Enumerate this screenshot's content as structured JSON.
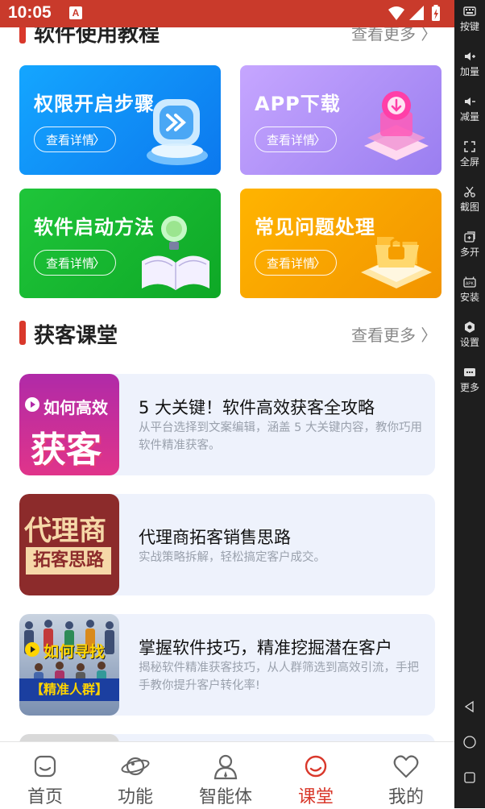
{
  "status_bar": {
    "time": "10:05",
    "app_icon": "A"
  },
  "side_bar": {
    "items": [
      {
        "label": "按键",
        "icon": "keyboard-icon"
      },
      {
        "label": "加量",
        "icon": "volume-up-icon"
      },
      {
        "label": "减量",
        "icon": "volume-down-icon"
      },
      {
        "label": "全屏",
        "icon": "fullscreen-icon"
      },
      {
        "label": "截图",
        "icon": "scissors-icon"
      },
      {
        "label": "多开",
        "icon": "multi-window-icon"
      },
      {
        "label": "安装",
        "icon": "apk-icon"
      },
      {
        "label": "设置",
        "icon": "settings-icon"
      },
      {
        "label": "更多",
        "icon": "more-icon"
      }
    ]
  },
  "tutorial_section": {
    "title": "软件使用教程",
    "see_more": "查看更多"
  },
  "tutorial_cards": [
    {
      "title": "权限开启步骤",
      "button": "查看详情",
      "color": "#1a8cf5"
    },
    {
      "title": "APP下载",
      "button": "查看详情",
      "color": "#a88cf2"
    },
    {
      "title": "软件启动方法",
      "button": "查看详情",
      "color": "#13b32f"
    },
    {
      "title": "常见问题处理",
      "button": "查看详情",
      "color": "#f0a300"
    }
  ],
  "course_section": {
    "title": "获客课堂",
    "see_more": "查看更多"
  },
  "lessons": [
    {
      "title": "5 大关键！软件高效获客全攻略",
      "desc": "从平台选择到文案编辑，涵盖 5 大关键内容，教你巧用软件精准获客。",
      "thumb_line1": "如何高效",
      "thumb_line2": "获客"
    },
    {
      "title": "代理商拓客销售思路",
      "desc": "实战策略拆解，轻松搞定客户成交。",
      "thumb_line1": "代理商",
      "thumb_line2": "拓客思路"
    },
    {
      "title": "掌握软件技巧，精准挖掘潜在客户",
      "desc": "揭秘软件精准获客技巧，从人群筛选到高效引流，手把手教你提升客户转化率!",
      "thumb_line1": "如何寻找",
      "thumb_line2": "【精准人群】"
    }
  ],
  "tab_bar": {
    "tabs": [
      {
        "label": "首页",
        "icon": "home-icon"
      },
      {
        "label": "功能",
        "icon": "planet-icon"
      },
      {
        "label": "智能体",
        "icon": "agent-icon"
      },
      {
        "label": "课堂",
        "icon": "classroom-icon"
      },
      {
        "label": "我的",
        "icon": "heart-icon"
      }
    ],
    "active": "课堂",
    "active_color": "#d9382b"
  }
}
